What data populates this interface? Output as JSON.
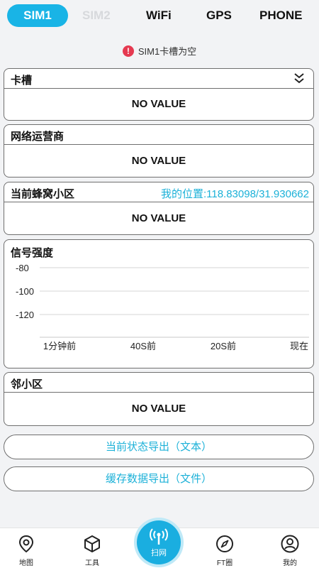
{
  "tabs": [
    "SIM1",
    "SIM2",
    "WiFi",
    "GPS",
    "PHONE"
  ],
  "warning": "SIM1卡槽为空",
  "card_slot": {
    "title": "卡槽",
    "value": "NO VALUE"
  },
  "operator": {
    "title": "网络运营商",
    "value": "NO VALUE"
  },
  "cell": {
    "title": "当前蜂窝小区",
    "location": "我的位置:118.83098/31.930662",
    "value": "NO VALUE"
  },
  "signal": {
    "title": "信号强度"
  },
  "neighbor": {
    "title": "邻小区",
    "value": "NO VALUE"
  },
  "buttons": {
    "export_status": "当前状态导出（文本）",
    "export_cache": "缓存数据导出（文件）"
  },
  "nav": {
    "map": "地图",
    "tools": "工具",
    "scan": "扫网",
    "ft": "FT圈",
    "me": "我的"
  },
  "chart_data": {
    "type": "line",
    "categories": [
      "1分钟前",
      "40S前",
      "20S前",
      "现在"
    ],
    "y_ticks": [
      -80,
      -100,
      -120
    ],
    "series": []
  }
}
